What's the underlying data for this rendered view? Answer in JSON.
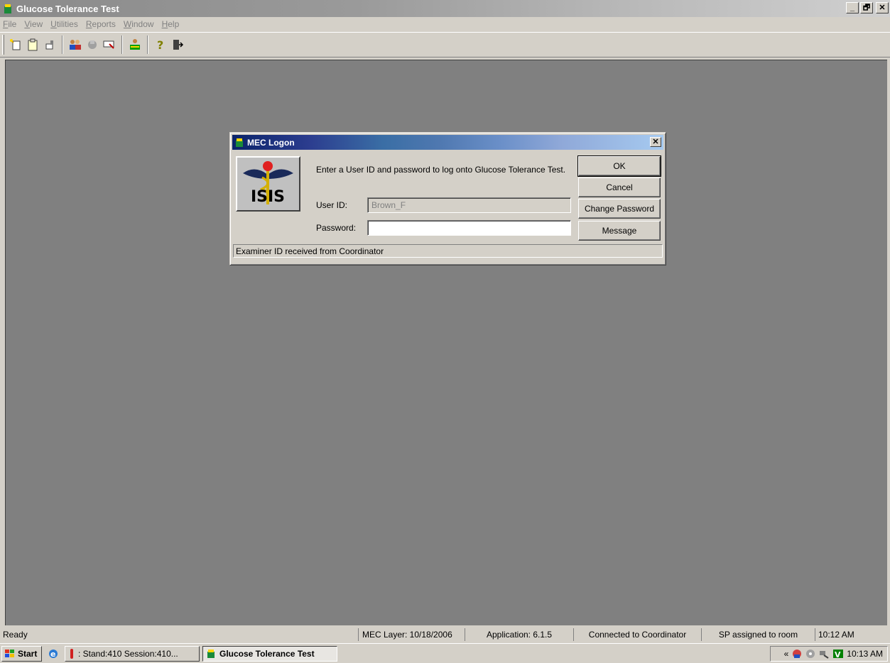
{
  "window": {
    "title": "Glucose Tolerance Test",
    "minimize": "_",
    "restore": "🗗",
    "close": "✕"
  },
  "menu": [
    {
      "u": "F",
      "rest": "ile"
    },
    {
      "u": "V",
      "rest": "iew"
    },
    {
      "u": "U",
      "rest": "tilities"
    },
    {
      "u": "R",
      "rest": "eports"
    },
    {
      "u": "W",
      "rest": "indow"
    },
    {
      "u": "H",
      "rest": "elp"
    }
  ],
  "dialog": {
    "title": "MEC Logon",
    "close": "✕",
    "message": "Enter a User ID and password to log onto Glucose Tolerance Test.",
    "user_id_label": "User ID:",
    "user_id_value": "Brown_F",
    "password_label": "Password:",
    "password_value": "",
    "buttons": {
      "ok": "OK",
      "cancel": "Cancel",
      "change_password": "Change Password",
      "message": "Message"
    },
    "status": "Examiner ID received from Coordinator",
    "logo_text": "ISIS"
  },
  "statusbar": {
    "ready": "Ready",
    "mec_layer": "MEC Layer: 10/18/2006",
    "application": "Application: 6.1.5",
    "connection": "Connected to Coordinator",
    "sp": "SP assigned to room",
    "time": "10:12 AM"
  },
  "taskbar": {
    "start": "Start",
    "task1": ": Stand:410 Session:410...",
    "task2": "Glucose Tolerance Test",
    "tray_chevron": "«",
    "clock": "10:13 AM"
  }
}
